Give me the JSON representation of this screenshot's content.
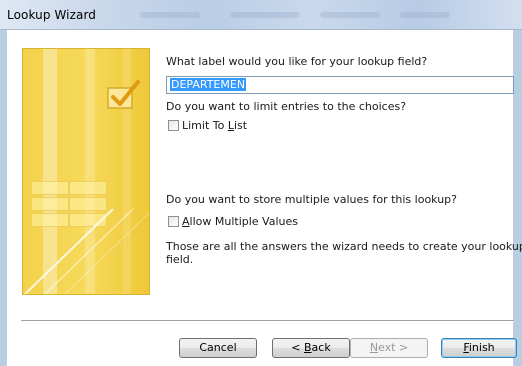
{
  "window": {
    "title": "Lookup Wizard"
  },
  "questions": {
    "label_question": "What label would you like for your lookup field?",
    "label_value": "DEPARTEMEN",
    "limit_question": "Do you want to limit entries to the choices?",
    "limit_checkbox": {
      "label_pre": "Limit To ",
      "label_accel": "L",
      "label_post": "ist",
      "checked": false
    },
    "multi_question": "Do you want to store multiple values for this lookup?",
    "multi_checkbox": {
      "label_pre": "",
      "label_accel": "A",
      "label_post": "llow Multiple Values",
      "checked": false
    },
    "final_line1": "Those are all the answers the wizard needs to create your lookup",
    "final_line2": "field."
  },
  "buttons": {
    "cancel": "Cancel",
    "back_pre": "< ",
    "back_accel": "B",
    "back_post": "ack",
    "next_pre": "",
    "next_accel": "N",
    "next_post": "ext >",
    "finish_pre": "",
    "finish_accel": "F",
    "finish_post": "inish"
  },
  "icons": {
    "art": "wizard-checkmark-illustration"
  },
  "colors": {
    "art_yellow": "#f3d24a",
    "selection": "#3399ff",
    "title_bar": "#c7d6ea"
  }
}
